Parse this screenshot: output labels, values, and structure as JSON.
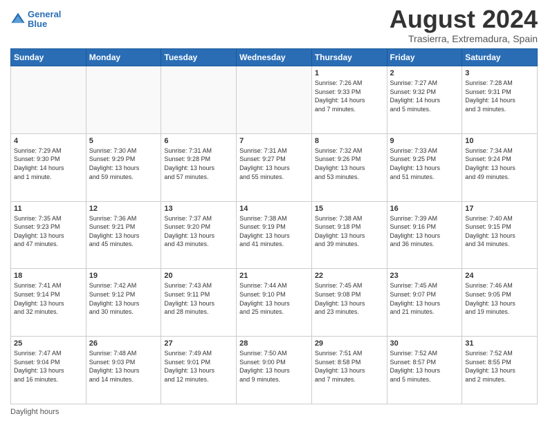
{
  "header": {
    "logo_line1": "General",
    "logo_line2": "Blue",
    "month_year": "August 2024",
    "location": "Trasierra, Extremadura, Spain"
  },
  "footer": {
    "daylight_label": "Daylight hours"
  },
  "days_of_week": [
    "Sunday",
    "Monday",
    "Tuesday",
    "Wednesday",
    "Thursday",
    "Friday",
    "Saturday"
  ],
  "weeks": [
    [
      {
        "day": "",
        "info": ""
      },
      {
        "day": "",
        "info": ""
      },
      {
        "day": "",
        "info": ""
      },
      {
        "day": "",
        "info": ""
      },
      {
        "day": "1",
        "info": "Sunrise: 7:26 AM\nSunset: 9:33 PM\nDaylight: 14 hours\nand 7 minutes."
      },
      {
        "day": "2",
        "info": "Sunrise: 7:27 AM\nSunset: 9:32 PM\nDaylight: 14 hours\nand 5 minutes."
      },
      {
        "day": "3",
        "info": "Sunrise: 7:28 AM\nSunset: 9:31 PM\nDaylight: 14 hours\nand 3 minutes."
      }
    ],
    [
      {
        "day": "4",
        "info": "Sunrise: 7:29 AM\nSunset: 9:30 PM\nDaylight: 14 hours\nand 1 minute."
      },
      {
        "day": "5",
        "info": "Sunrise: 7:30 AM\nSunset: 9:29 PM\nDaylight: 13 hours\nand 59 minutes."
      },
      {
        "day": "6",
        "info": "Sunrise: 7:31 AM\nSunset: 9:28 PM\nDaylight: 13 hours\nand 57 minutes."
      },
      {
        "day": "7",
        "info": "Sunrise: 7:31 AM\nSunset: 9:27 PM\nDaylight: 13 hours\nand 55 minutes."
      },
      {
        "day": "8",
        "info": "Sunrise: 7:32 AM\nSunset: 9:26 PM\nDaylight: 13 hours\nand 53 minutes."
      },
      {
        "day": "9",
        "info": "Sunrise: 7:33 AM\nSunset: 9:25 PM\nDaylight: 13 hours\nand 51 minutes."
      },
      {
        "day": "10",
        "info": "Sunrise: 7:34 AM\nSunset: 9:24 PM\nDaylight: 13 hours\nand 49 minutes."
      }
    ],
    [
      {
        "day": "11",
        "info": "Sunrise: 7:35 AM\nSunset: 9:23 PM\nDaylight: 13 hours\nand 47 minutes."
      },
      {
        "day": "12",
        "info": "Sunrise: 7:36 AM\nSunset: 9:21 PM\nDaylight: 13 hours\nand 45 minutes."
      },
      {
        "day": "13",
        "info": "Sunrise: 7:37 AM\nSunset: 9:20 PM\nDaylight: 13 hours\nand 43 minutes."
      },
      {
        "day": "14",
        "info": "Sunrise: 7:38 AM\nSunset: 9:19 PM\nDaylight: 13 hours\nand 41 minutes."
      },
      {
        "day": "15",
        "info": "Sunrise: 7:38 AM\nSunset: 9:18 PM\nDaylight: 13 hours\nand 39 minutes."
      },
      {
        "day": "16",
        "info": "Sunrise: 7:39 AM\nSunset: 9:16 PM\nDaylight: 13 hours\nand 36 minutes."
      },
      {
        "day": "17",
        "info": "Sunrise: 7:40 AM\nSunset: 9:15 PM\nDaylight: 13 hours\nand 34 minutes."
      }
    ],
    [
      {
        "day": "18",
        "info": "Sunrise: 7:41 AM\nSunset: 9:14 PM\nDaylight: 13 hours\nand 32 minutes."
      },
      {
        "day": "19",
        "info": "Sunrise: 7:42 AM\nSunset: 9:12 PM\nDaylight: 13 hours\nand 30 minutes."
      },
      {
        "day": "20",
        "info": "Sunrise: 7:43 AM\nSunset: 9:11 PM\nDaylight: 13 hours\nand 28 minutes."
      },
      {
        "day": "21",
        "info": "Sunrise: 7:44 AM\nSunset: 9:10 PM\nDaylight: 13 hours\nand 25 minutes."
      },
      {
        "day": "22",
        "info": "Sunrise: 7:45 AM\nSunset: 9:08 PM\nDaylight: 13 hours\nand 23 minutes."
      },
      {
        "day": "23",
        "info": "Sunrise: 7:45 AM\nSunset: 9:07 PM\nDaylight: 13 hours\nand 21 minutes."
      },
      {
        "day": "24",
        "info": "Sunrise: 7:46 AM\nSunset: 9:05 PM\nDaylight: 13 hours\nand 19 minutes."
      }
    ],
    [
      {
        "day": "25",
        "info": "Sunrise: 7:47 AM\nSunset: 9:04 PM\nDaylight: 13 hours\nand 16 minutes."
      },
      {
        "day": "26",
        "info": "Sunrise: 7:48 AM\nSunset: 9:03 PM\nDaylight: 13 hours\nand 14 minutes."
      },
      {
        "day": "27",
        "info": "Sunrise: 7:49 AM\nSunset: 9:01 PM\nDaylight: 13 hours\nand 12 minutes."
      },
      {
        "day": "28",
        "info": "Sunrise: 7:50 AM\nSunset: 9:00 PM\nDaylight: 13 hours\nand 9 minutes."
      },
      {
        "day": "29",
        "info": "Sunrise: 7:51 AM\nSunset: 8:58 PM\nDaylight: 13 hours\nand 7 minutes."
      },
      {
        "day": "30",
        "info": "Sunrise: 7:52 AM\nSunset: 8:57 PM\nDaylight: 13 hours\nand 5 minutes."
      },
      {
        "day": "31",
        "info": "Sunrise: 7:52 AM\nSunset: 8:55 PM\nDaylight: 13 hours\nand 2 minutes."
      }
    ]
  ]
}
